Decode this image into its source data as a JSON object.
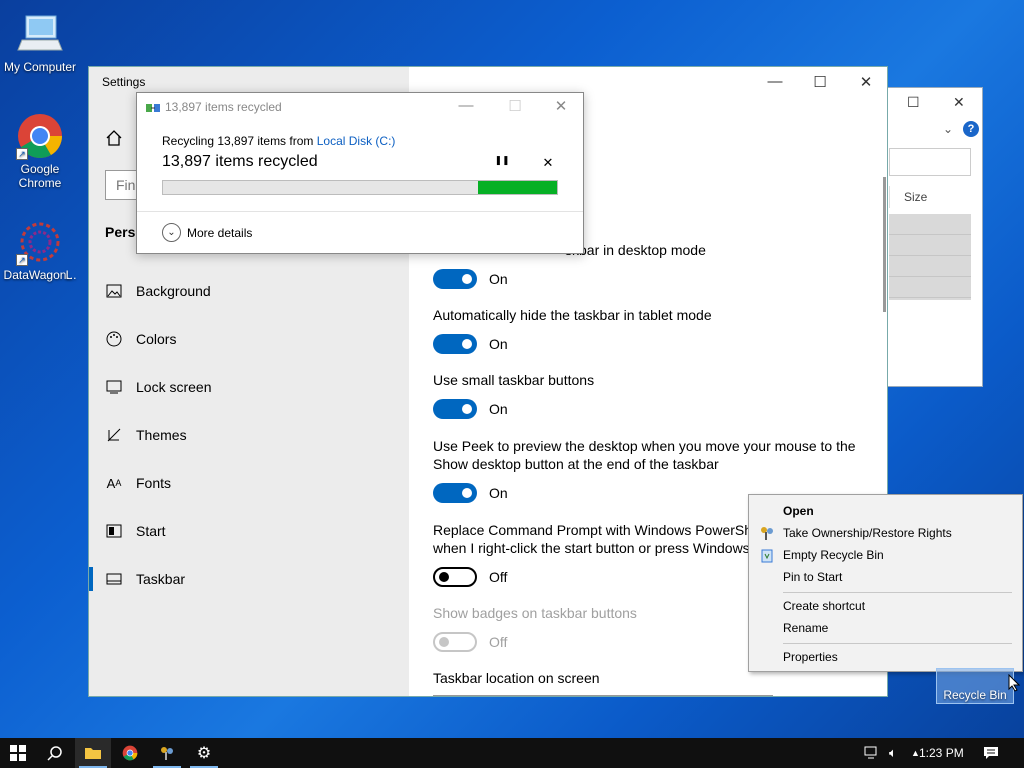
{
  "desktop": {
    "icons": [
      {
        "label": "My Computer"
      },
      {
        "label": "Google\nChrome"
      },
      {
        "label": "DataWagon..."
      }
    ],
    "partial_icon_letter": "L",
    "recycle_bin_label": "Recycle Bin"
  },
  "explorer": {
    "size_header": "Size",
    "help": "?"
  },
  "settings": {
    "title": "Settings",
    "find_placeholder": "Find",
    "section": "Personalization",
    "section_visible": "Perso",
    "nav": [
      {
        "label": "Background",
        "icon": "image-icon"
      },
      {
        "label": "Colors",
        "icon": "palette-icon"
      },
      {
        "label": "Lock screen",
        "icon": "monitor-icon"
      },
      {
        "label": "Themes",
        "icon": "brush-icon"
      },
      {
        "label": "Fonts",
        "icon": "font-icon"
      },
      {
        "label": "Start",
        "icon": "start-icon"
      },
      {
        "label": "Taskbar",
        "icon": "taskbar-icon",
        "active": true
      }
    ],
    "options": [
      {
        "label": "skbar in desktop mode",
        "state": "On",
        "enabled": true
      },
      {
        "label": "Automatically hide the taskbar in tablet mode",
        "state": "On",
        "enabled": true
      },
      {
        "label": "Use small taskbar buttons",
        "state": "On",
        "enabled": true
      },
      {
        "label": "Use Peek to preview the desktop when you move your mouse to the\nShow desktop button at the end of the taskbar",
        "state": "On",
        "enabled": true
      },
      {
        "label": "Replace Command Prompt with Windows PowerShe\nwhen I right-click the start button or press Windows",
        "state": "Off",
        "enabled": true
      },
      {
        "label": "Show badges on taskbar buttons",
        "state": "Off",
        "enabled": false
      }
    ],
    "location_label": "Taskbar location on screen"
  },
  "progress": {
    "title": "13,897 items recycled",
    "line1_prefix": "Recycling 13,897 items from ",
    "line1_link": "Local Disk (C:)",
    "line2": "13,897 items recycled",
    "pause_glyph": "❚❚",
    "close_glyph": "✕",
    "progress_fraction": 0.2,
    "more_details": "More details"
  },
  "context_menu": {
    "items": [
      {
        "label": "Open",
        "bold": true
      },
      {
        "label": "Take Ownership/Restore Rights",
        "icon": "ownership-icon"
      },
      {
        "label": "Empty Recycle Bin",
        "icon": "recycle-icon"
      },
      {
        "label": "Pin to Start"
      },
      {
        "label": "Create shortcut"
      },
      {
        "label": "Rename"
      },
      {
        "label": "Properties"
      }
    ]
  },
  "taskbar": {
    "time": "1:23 PM"
  }
}
